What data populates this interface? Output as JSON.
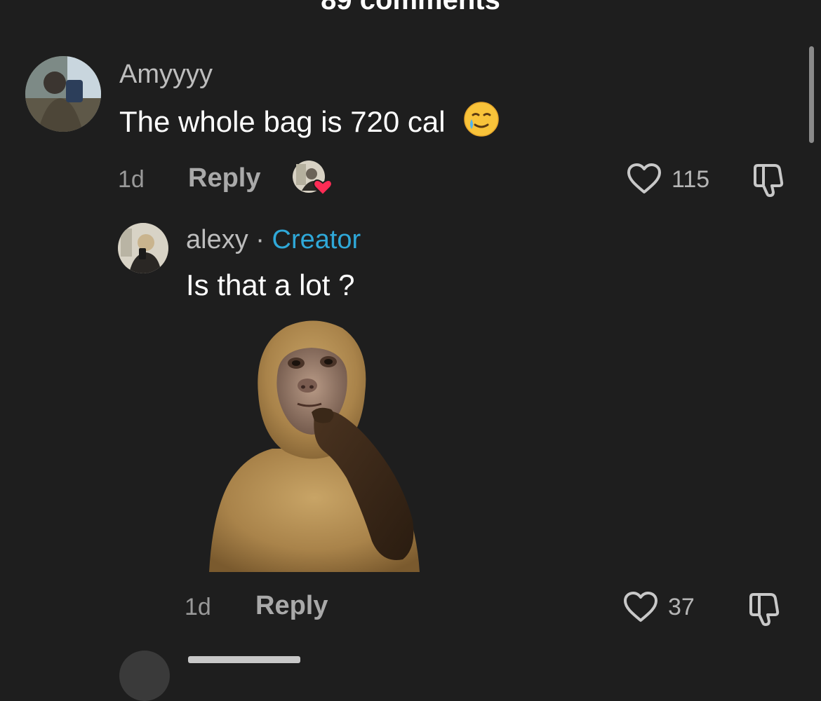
{
  "header": {
    "comments_count_label": "89 comments"
  },
  "comments": [
    {
      "username": "Amyyyy",
      "text": "The whole bag is 720 cal",
      "emoji": "🥲",
      "time": "1d",
      "reply_label": "Reply",
      "likes": "115",
      "creator_liked": true,
      "avatar_icon": "user-avatar"
    }
  ],
  "reply": {
    "username": "alexy",
    "separator": "·",
    "badge": "Creator",
    "text": "Is that a lot ?",
    "sticker": "thinking-monkey-sticker",
    "time": "1d",
    "reply_label": "Reply",
    "likes": "37"
  },
  "colors": {
    "background": "#1e1e1e",
    "creator_badge": "#2fa8d8",
    "heart_badge": "#fe2c55"
  }
}
